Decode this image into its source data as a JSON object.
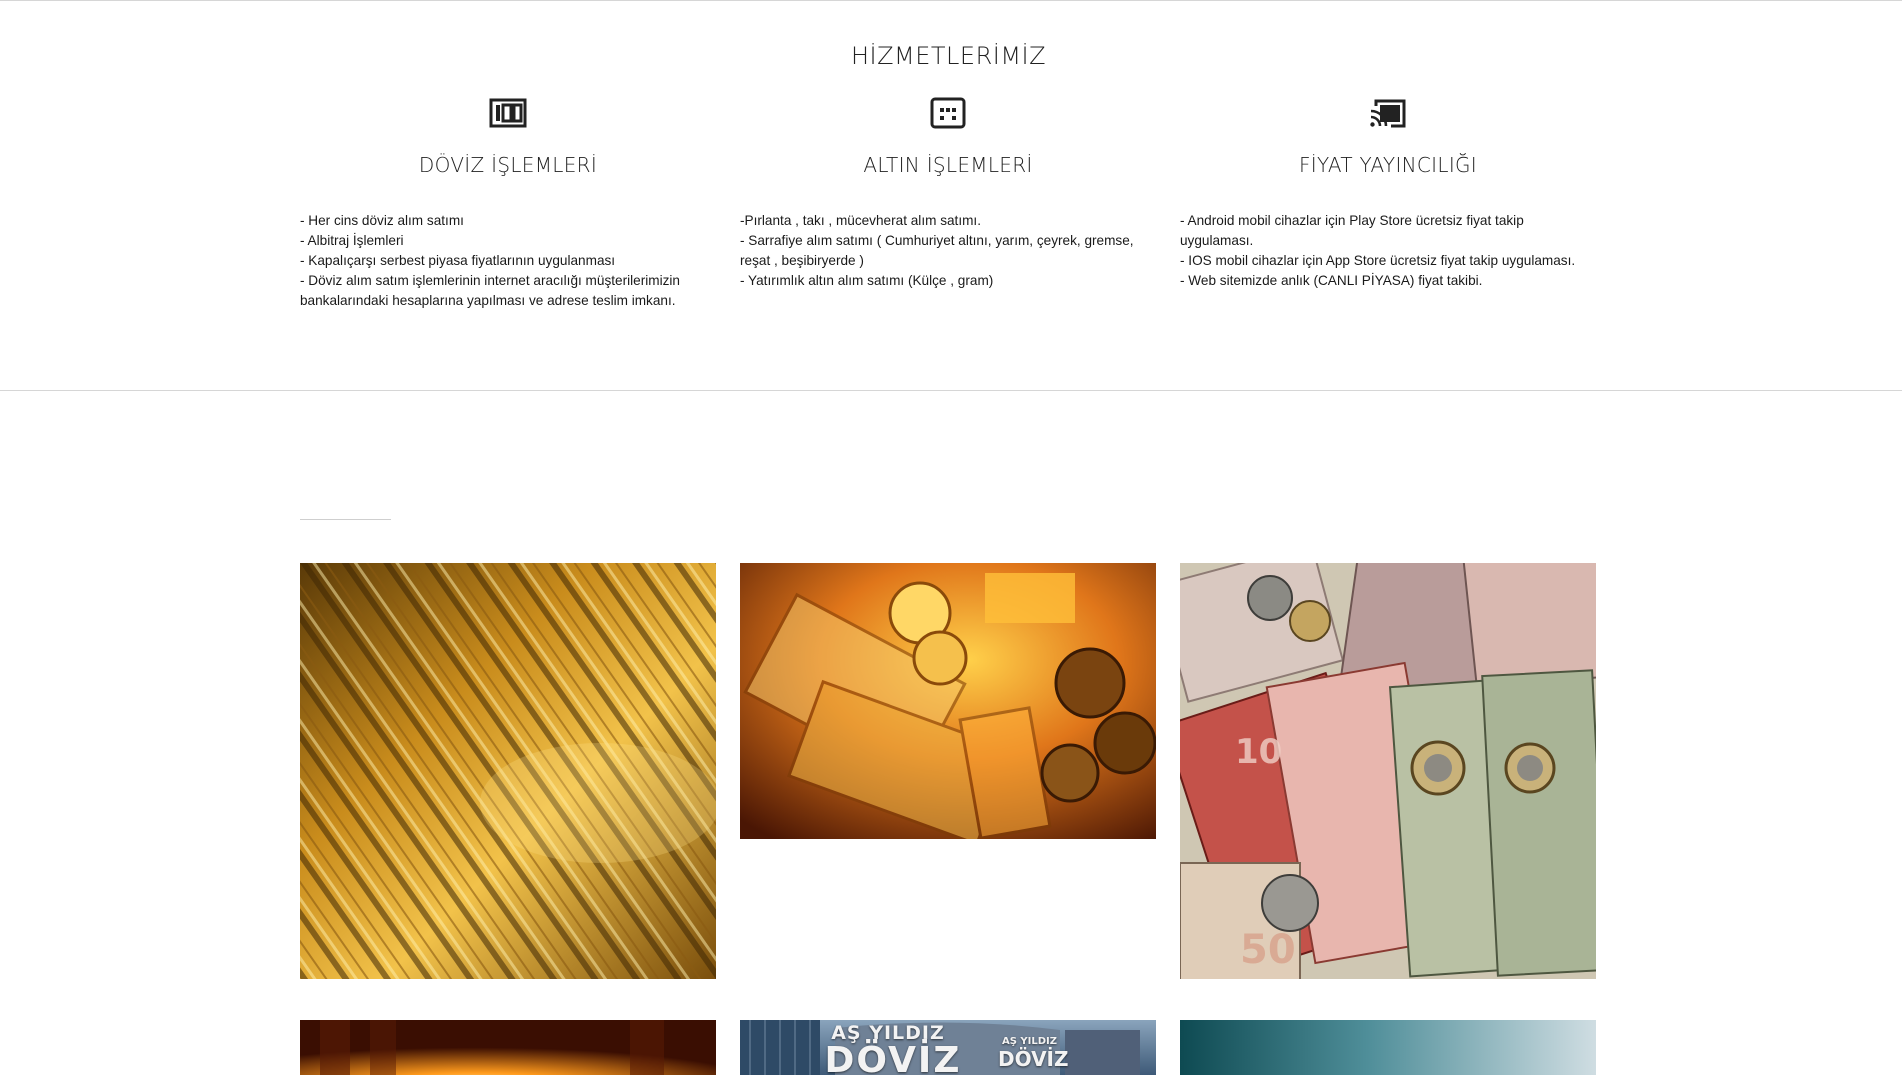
{
  "services": {
    "title": "HİZMETLERİMİZ",
    "items": [
      {
        "icon": "hundred-icon",
        "title": "DÖVİZ İŞLEMLERİ",
        "lines": [
          "- Her cins döviz alım satımı",
          "- Albitraj İşlemleri",
          "- Kapalıçarşı serbest piyasa fiyatlarının uygulanması",
          "- Döviz alım satım işlemlerinin internet aracılığı müşterilerimizin bankalarındaki hesaplarına yapılması ve adrese teslim imkanı."
        ]
      },
      {
        "icon": "dots-box-icon",
        "title": "ALTIN İŞLEMLERİ",
        "lines": [
          "-Pırlanta , takı , mücevherat alım satımı.",
          "- Sarrafiye alım satımı ( Cumhuriyet altını, yarım, çeyrek, gremse, reşat , beşibiryerde )",
          "- Yatırımlık altın alım satımı (Külçe , gram)"
        ]
      },
      {
        "icon": "cast-icon",
        "title": "FİYAT YAYINCILIĞI",
        "lines": [
          "- Android mobil cihazlar için Play Store ücretsiz fiyat takip uygulaması.",
          "- IOS mobil cihazlar için App Store ücretsiz fiyat takip uygulaması.",
          "- Web sitemizde anlık (CANLI PİYASA) fiyat takibi."
        ]
      }
    ]
  },
  "gallery": {
    "items": [
      {
        "name": "gold-bangles-photo"
      },
      {
        "name": "gold-and-banknotes-photo"
      },
      {
        "name": "mixed-currency-photo"
      },
      {
        "name": "molten-gold-photo"
      },
      {
        "name": "storefront-sign-photo",
        "sign_line1": "AŞ YILDIZ",
        "sign_line2": "DÖVİZ",
        "sign_small1": "AŞ YILDIZ",
        "sign_small2": "DÖVİZ"
      },
      {
        "name": "blue-abstract-photo"
      }
    ]
  },
  "colors": {
    "text": "#222222",
    "divider": "#d6d6d6",
    "gold": "#d9a21b"
  }
}
